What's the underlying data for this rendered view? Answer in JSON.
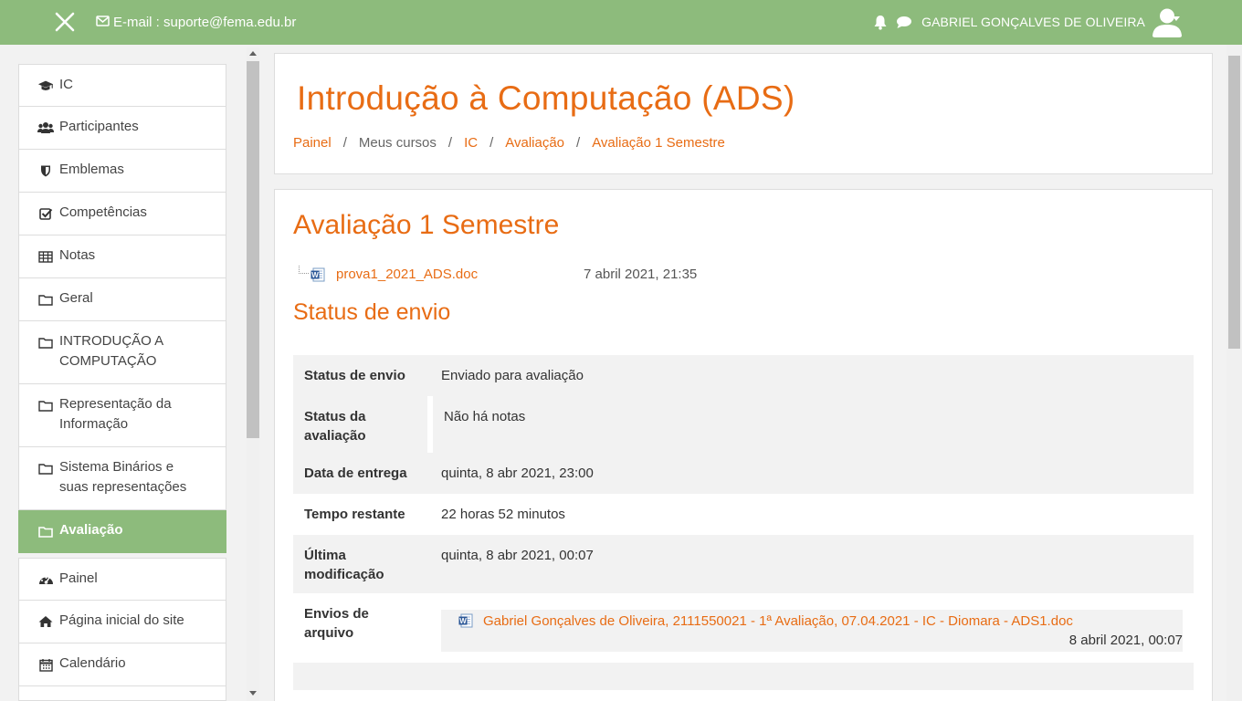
{
  "navbar": {
    "email_label": "E-mail : suporte@fema.edu.br",
    "user_name": "GABRIEL GONÇALVES DE OLIVEIRA",
    "bg_color": "#8dbb7c",
    "icons": [
      "close-icon",
      "envelope-icon",
      "bell-icon",
      "chat-icon",
      "avatar-icon",
      "caret-down-icon"
    ]
  },
  "sidebar": {
    "items": [
      {
        "label": "IC",
        "icon": "graduation-cap-icon"
      },
      {
        "label": "Participantes",
        "icon": "users-icon"
      },
      {
        "label": "Emblemas",
        "icon": "shield-icon"
      },
      {
        "label": "Competências",
        "icon": "checkbox-icon"
      },
      {
        "label": "Notas",
        "icon": "table-icon"
      },
      {
        "label": "Geral",
        "icon": "folder-icon"
      },
      {
        "label": "INTRODUÇÃO A COMPUTAÇÃO",
        "icon": "folder-icon"
      },
      {
        "label": "Representação da Informação",
        "icon": "folder-icon"
      },
      {
        "label": "Sistema Binários e suas representações",
        "icon": "folder-icon"
      },
      {
        "label": "Avaliação",
        "icon": "folder-icon",
        "active": true
      },
      {
        "label": "Painel",
        "icon": "dashboard-icon"
      },
      {
        "label": "Página inicial do site",
        "icon": "home-icon"
      },
      {
        "label": "Calendário",
        "icon": "calendar-icon"
      }
    ]
  },
  "header": {
    "course_title": "Introdução à Computação (ADS)",
    "breadcrumb": [
      "Painel",
      "Meus cursos",
      "IC",
      "Avaliação",
      "Avaliação 1 Semestre"
    ],
    "separator": "/"
  },
  "main": {
    "title": "Avaliação 1 Semestre",
    "file": {
      "name": "prova1_2021_ADS.doc",
      "date": "7 abril 2021, 21:35"
    },
    "section_title": "Status de envio",
    "rows": [
      {
        "key": "Status de envio",
        "value": "Enviado para avaliação"
      },
      {
        "key": "Status da avaliação",
        "value": "Não há notas"
      },
      {
        "key": "Data de entrega",
        "value": "quinta, 8 abr 2021, 23:00"
      },
      {
        "key": "Tempo restante",
        "value": "22 horas 52 minutos"
      },
      {
        "key": "Última modificação",
        "value": "quinta, 8 abr 2021, 00:07"
      },
      {
        "key": "Envios de arquivo",
        "file_name": "Gabriel Gonçalves de Oliveira, 2111550021 - 1ª Avaliação, 07.04.2021 - IC - Diomara - ADS1.doc",
        "file_date": "8 abril 2021, 00:07"
      }
    ]
  },
  "accent_color": "#e86c14"
}
